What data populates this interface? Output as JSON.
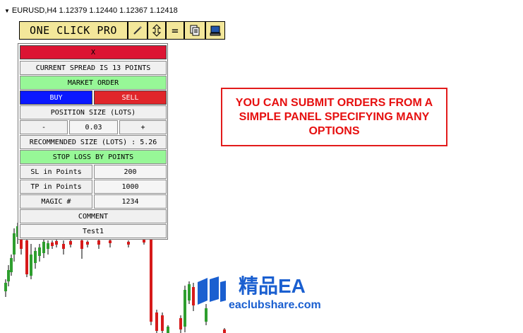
{
  "chart": {
    "header": "EURUSD,H4  1.12379 1.12440 1.12367 1.12418",
    "colors": {
      "bull": "#2e9e2e",
      "bear": "#d61a1a"
    }
  },
  "toolbar": {
    "title": "ONE CLICK PRO",
    "icons": [
      "pencil-icon",
      "up-down-arrows-icon",
      "equals-icon",
      "documents-icon",
      "monitor-icon"
    ],
    "equals_label": "="
  },
  "panel": {
    "close_label": "X",
    "spread_label": "CURRENT SPREAD IS 13 POINTS",
    "market_order_label": "MARKET ORDER",
    "buy_label": "BUY",
    "sell_label": "SELL",
    "position_size_label": "POSITION SIZE (LOTS)",
    "minus_label": "-",
    "lots_value": "0.03",
    "plus_label": "+",
    "recommended_label": "RECOMMENDED SIZE (LOTS) : 5.26",
    "stop_loss_mode_label": "STOP LOSS BY POINTS",
    "sl_label": "SL in Points",
    "sl_value": "200",
    "tp_label": "TP in Points",
    "tp_value": "1000",
    "magic_label": "MAGIC #",
    "magic_value": "1234",
    "comment_label": "COMMENT",
    "comment_value": "Test1"
  },
  "callout": {
    "text": "YOU CAN SUBMIT ORDERS FROM A SIMPLE PANEL SPECIFYING MANY OPTIONS"
  },
  "logo": {
    "main": "精品EA",
    "sub": "eaclubshare.com",
    "color": "#1a5fd0"
  }
}
